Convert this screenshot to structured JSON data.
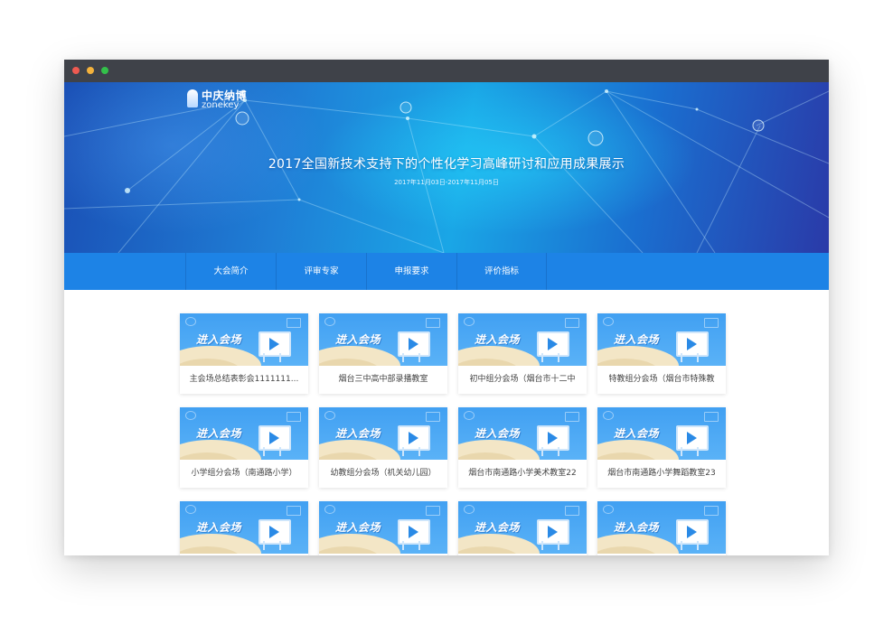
{
  "window": {
    "controls": [
      "close",
      "minimize",
      "maximize"
    ],
    "colors": {
      "titlebar": "#3f4249",
      "close": "#ee5a51",
      "minimize": "#f4b23c",
      "maximize": "#33c04a"
    }
  },
  "banner": {
    "logo_cn": "中庆纳博",
    "logo_en": "zonekey",
    "title": "2017全国新技术支持下的个性化学习高峰研讨和应用成果展示",
    "date": "2017年11月03日-2017年11月05日"
  },
  "nav": {
    "items": [
      {
        "label": "大会简介"
      },
      {
        "label": "评审专家"
      },
      {
        "label": "申报要求"
      },
      {
        "label": "评价指标"
      }
    ]
  },
  "cards": [
    {
      "thumb_text": "进入会场",
      "label": "主会场总结表彰会1111111..."
    },
    {
      "thumb_text": "进入会场",
      "label": "烟台三中高中部录播教室"
    },
    {
      "thumb_text": "进入会场",
      "label": "初中组分会场（烟台市十二中"
    },
    {
      "thumb_text": "进入会场",
      "label": "特教组分会场（烟台市特殊教"
    },
    {
      "thumb_text": "进入会场",
      "label": "小学组分会场（南通路小学）"
    },
    {
      "thumb_text": "进入会场",
      "label": "幼教组分会场（机关幼儿园）"
    },
    {
      "thumb_text": "进入会场",
      "label": "烟台市南通路小学美术教室22"
    },
    {
      "thumb_text": "进入会场",
      "label": "烟台市南通路小学舞蹈教室23"
    },
    {
      "thumb_text": "进入会场",
      "label": ""
    },
    {
      "thumb_text": "进入会场",
      "label": ""
    },
    {
      "thumb_text": "进入会场",
      "label": ""
    },
    {
      "thumb_text": "进入会场",
      "label": ""
    }
  ],
  "colors": {
    "nav_bg": "#1d83e6",
    "banner_deep": "#1a4fb5",
    "banner_light": "#1aa6e6",
    "thumb_bg": "#41a0f2"
  }
}
